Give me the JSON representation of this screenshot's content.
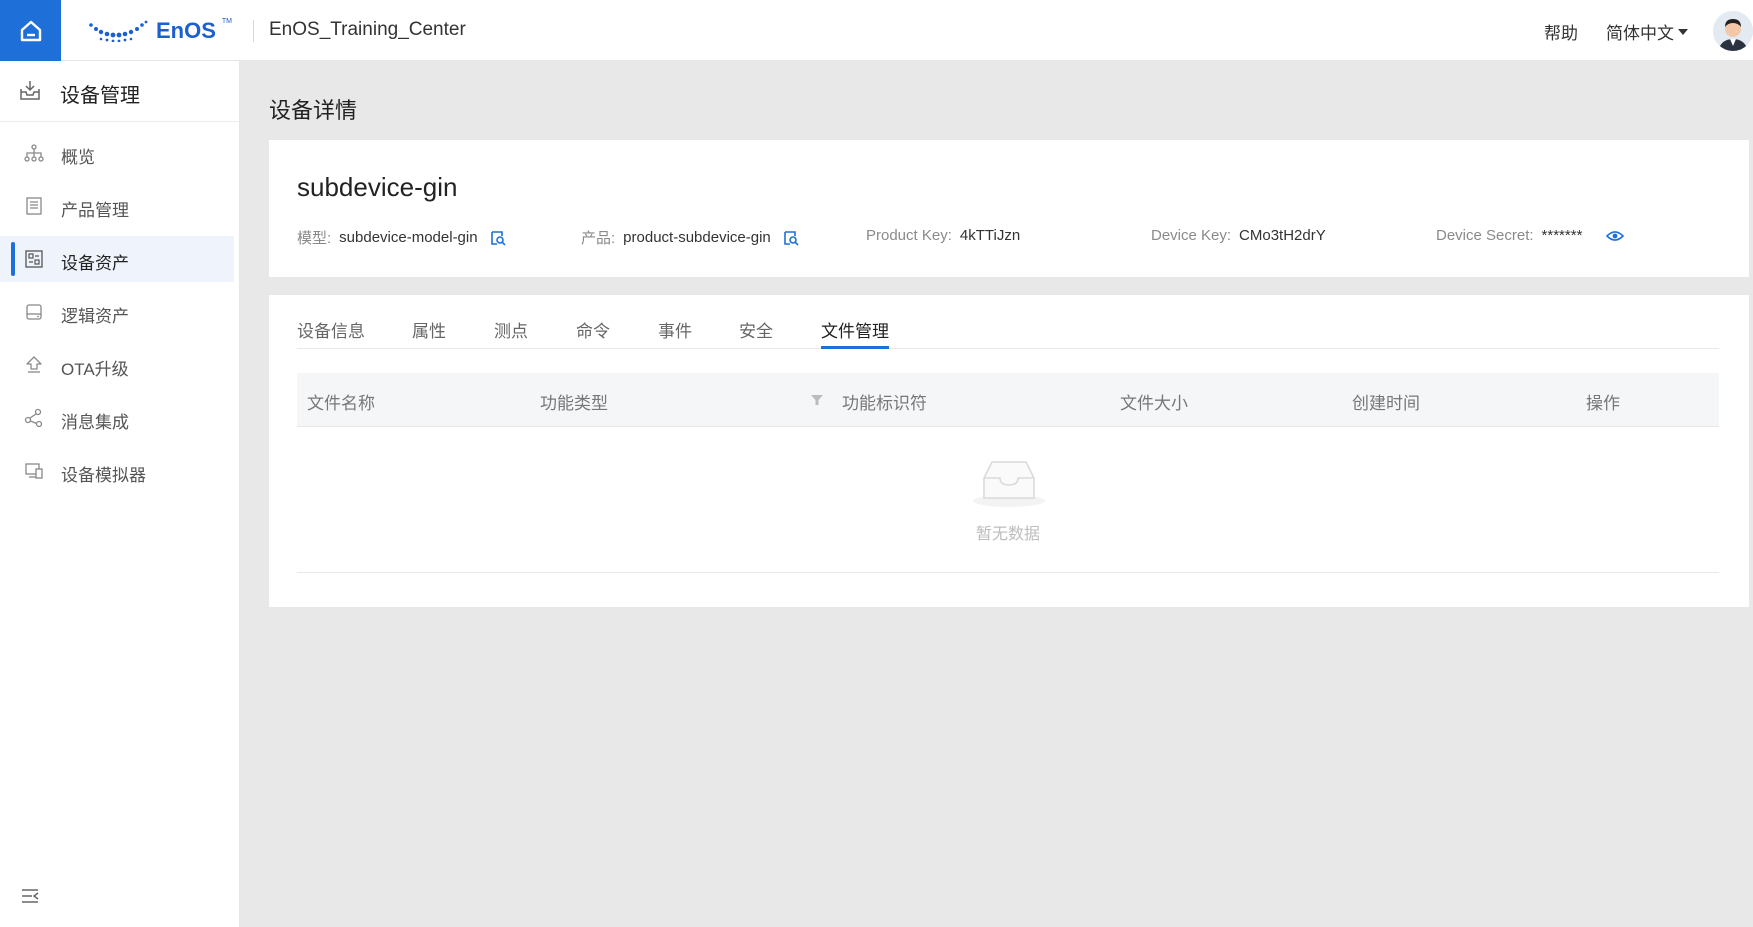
{
  "header": {
    "org_name": "EnOS_Training_Center",
    "logo_text": "EnOS",
    "logo_tm": "TM",
    "help": "帮助",
    "language": "简体中文"
  },
  "sidebar": {
    "title": "设备管理",
    "items": [
      {
        "label": "概览",
        "icon": "hierarchy-icon"
      },
      {
        "label": "产品管理",
        "icon": "document-icon"
      },
      {
        "label": "设备资产",
        "icon": "device-asset-icon",
        "active": true
      },
      {
        "label": "逻辑资产",
        "icon": "drive-icon"
      },
      {
        "label": "OTA升级",
        "icon": "upload-icon"
      },
      {
        "label": "消息集成",
        "icon": "share-nodes-icon"
      },
      {
        "label": "设备模拟器",
        "icon": "monitor-icon"
      }
    ]
  },
  "page": {
    "title": "设备详情"
  },
  "device": {
    "name": "subdevice-gin",
    "model_key": "模型:",
    "model_value": "subdevice-model-gin",
    "product_key_label": "产品:",
    "product_value": "product-subdevice-gin",
    "pk_label": "Product Key:",
    "pk_value": "4kTTiJzn",
    "dk_label": "Device Key:",
    "dk_value": "CMo3tH2drY",
    "ds_label": "Device Secret:",
    "ds_value": "*******"
  },
  "tabs": [
    "设备信息",
    "属性",
    "测点",
    "命令",
    "事件",
    "安全",
    "文件管理"
  ],
  "active_tab": "文件管理",
  "table": {
    "columns": [
      "文件名称",
      "功能类型",
      "功能标识符",
      "文件大小",
      "创建时间",
      "操作"
    ],
    "empty_text": "暂无数据"
  },
  "colors": {
    "accent": "#1f6fd8",
    "background": "#e8e8e8"
  }
}
